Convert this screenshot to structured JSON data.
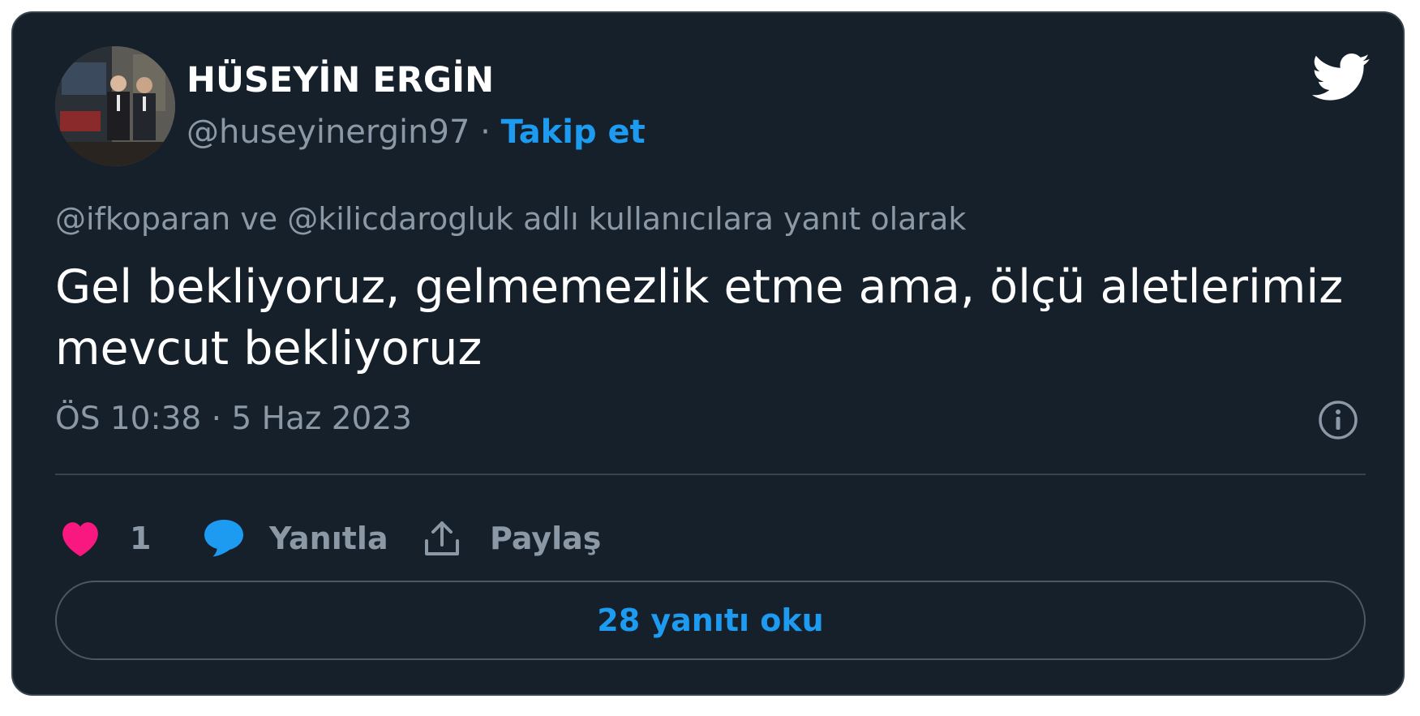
{
  "author": {
    "display_name": "HÜSEYİN ERGİN",
    "handle": "@huseyinergin97",
    "separator": " · ",
    "follow_label": "Takip et"
  },
  "tweet": {
    "reply_context": "@ifkoparan ve @kilicdarogluk adlı kullanıcılara yanıt olarak",
    "text_line1": "Gel bekliyoruz, gelmemezlik etme ama, ölçü aletlerimiz",
    "text_line2": "mevcut bekliyoruz",
    "timestamp": "ÖS 10:38 · 5 Haz 2023"
  },
  "actions": {
    "like_count": "1",
    "reply_label": "Yanıtla",
    "share_label": "Paylaş"
  },
  "footer": {
    "read_replies_label": "28 yanıtı oku"
  },
  "colors": {
    "background": "#15202b",
    "border": "#38444d",
    "accent": "#1d9bf0",
    "like": "#f91880",
    "muted": "#8b98a5",
    "text": "#ffffff"
  },
  "icons": {
    "logo": "twitter-bird-icon",
    "info": "info-icon",
    "like": "heart-icon",
    "reply": "speech-bubble-icon",
    "share": "share-upload-icon"
  }
}
